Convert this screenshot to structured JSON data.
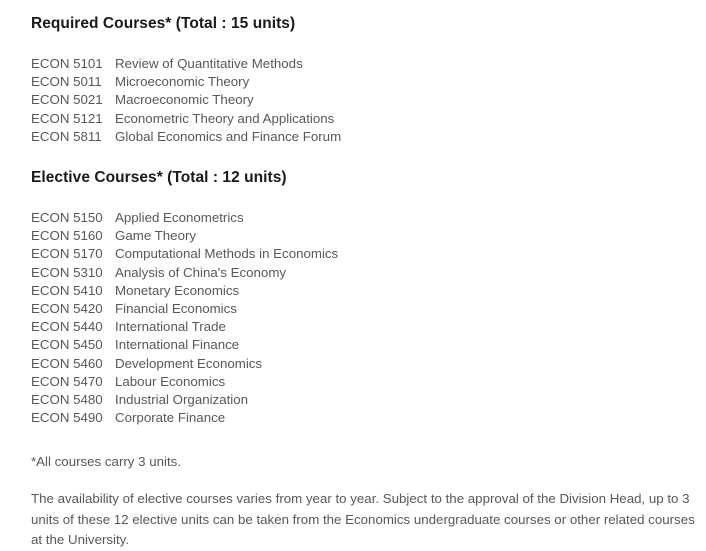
{
  "document": {
    "required_section": {
      "heading": "Required Courses* (Total : 15 units)",
      "courses": [
        {
          "code": "ECON 5101",
          "title": "Review of Quantitative Methods"
        },
        {
          "code": "ECON 5011",
          "title": "Microeconomic Theory"
        },
        {
          "code": "ECON 5021",
          "title": "Macroeconomic Theory"
        },
        {
          "code": "ECON 5121",
          "title": "Econometric Theory and Applications"
        },
        {
          "code": "ECON 5811",
          "title": "Global Economics and Finance Forum"
        }
      ]
    },
    "elective_section": {
      "heading": "Elective Courses* (Total : 12 units)",
      "courses": [
        {
          "code": "ECON 5150",
          "title": "Applied Econometrics"
        },
        {
          "code": "ECON 5160",
          "title": "Game Theory"
        },
        {
          "code": "ECON 5170",
          "title": "Computational Methods in Economics"
        },
        {
          "code": "ECON 5310",
          "title": "Analysis of China's Economy"
        },
        {
          "code": "ECON 5410",
          "title": "Monetary Economics"
        },
        {
          "code": "ECON 5420",
          "title": "Financial Economics"
        },
        {
          "code": "ECON 5440",
          "title": "International Trade"
        },
        {
          "code": "ECON 5450",
          "title": "International Finance"
        },
        {
          "code": "ECON 5460",
          "title": "Development Economics"
        },
        {
          "code": "ECON 5470",
          "title": "Labour Economics"
        },
        {
          "code": "ECON 5480",
          "title": "Industrial Organization"
        },
        {
          "code": "ECON 5490",
          "title": "Corporate Finance"
        }
      ]
    },
    "notes": {
      "units_note": "*All courses carry 3 units.",
      "availability_note": "The availability of elective courses varies from year to year. Subject to the approval of the Division Head, up to 3 units of these 12 elective units can be taken from the Economics undergraduate courses or other related courses at the University."
    },
    "colors": {
      "background": "#ffffff",
      "heading_text": "#1a1a1a",
      "body_text": "#55585c"
    }
  }
}
